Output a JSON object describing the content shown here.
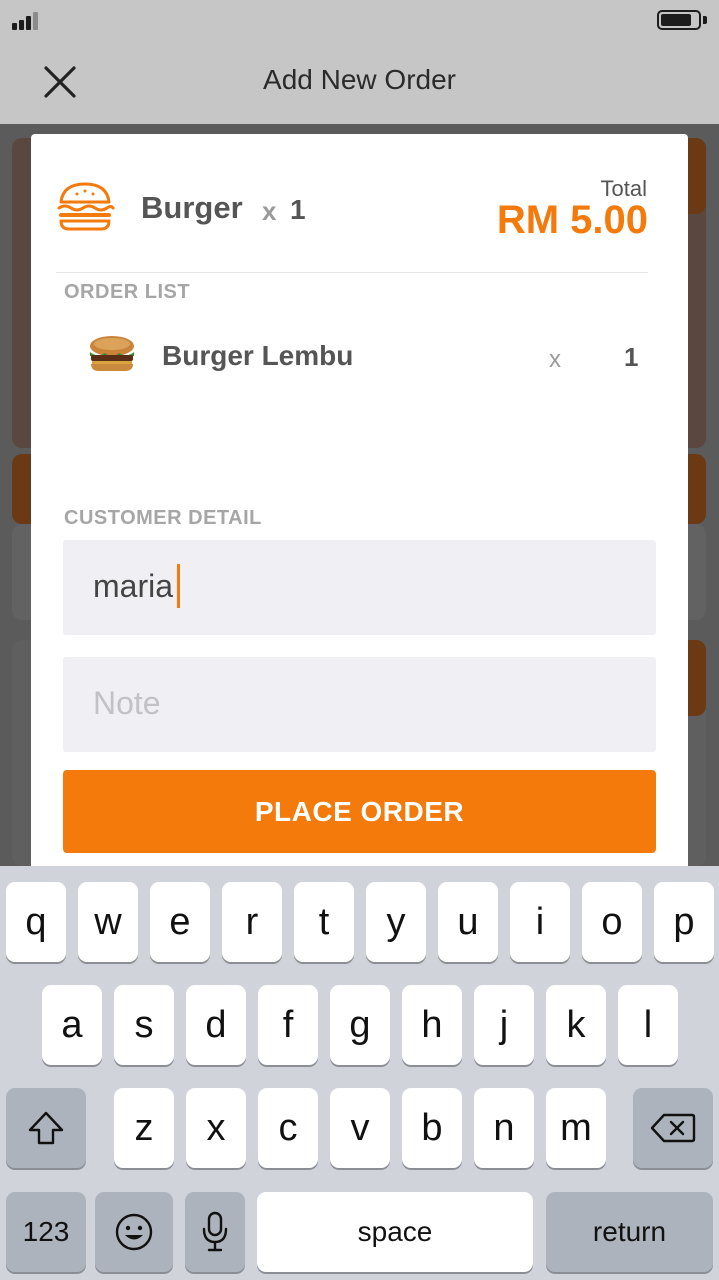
{
  "header": {
    "title": "Add New Order"
  },
  "summary": {
    "item_name": "Burger",
    "qty_symbol": "x",
    "qty": "1",
    "total_label": "Total",
    "total_value": "RM 5.00"
  },
  "order_list": {
    "label": "ORDER LIST",
    "items": [
      {
        "name": "Burger Lembu",
        "x": "x",
        "qty": "1"
      }
    ]
  },
  "customer": {
    "label": "CUSTOMER DETAIL",
    "name_value": "maria",
    "note_placeholder": "Note"
  },
  "actions": {
    "place_order": "PLACE ORDER"
  },
  "keyboard": {
    "row1": [
      "q",
      "w",
      "e",
      "r",
      "t",
      "y",
      "u",
      "i",
      "o",
      "p"
    ],
    "row2": [
      "a",
      "s",
      "d",
      "f",
      "g",
      "h",
      "j",
      "k",
      "l"
    ],
    "row3": [
      "z",
      "x",
      "c",
      "v",
      "b",
      "n",
      "m"
    ],
    "numbers_key": "123",
    "space_key": "space",
    "return_key": "return"
  },
  "colors": {
    "accent": "#f47a0c",
    "field_bg": "#efeff4",
    "keyboard_bg": "#d0d3da"
  },
  "icons": [
    "close-icon",
    "burger-icon",
    "shift-icon",
    "backspace-icon",
    "emoji-icon",
    "microphone-icon"
  ]
}
